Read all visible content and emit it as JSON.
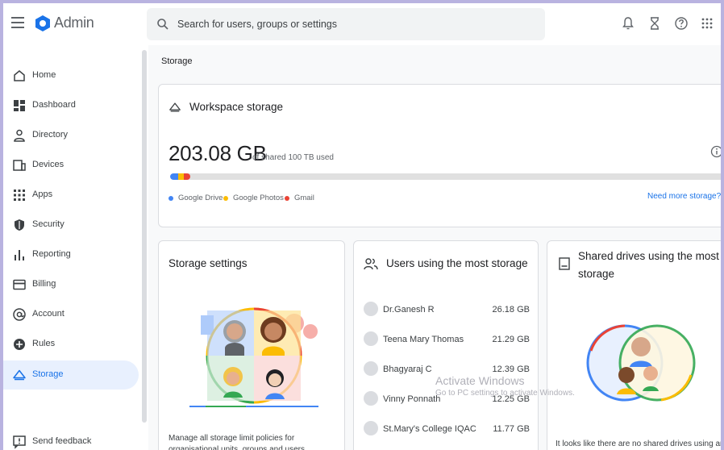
{
  "header": {
    "app_title": "Admin",
    "search_placeholder": "Search for users, groups or settings"
  },
  "sidebar": {
    "items": [
      {
        "label": "Home",
        "icon": "home-icon"
      },
      {
        "label": "Dashboard",
        "icon": "dashboard-icon"
      },
      {
        "label": "Directory",
        "icon": "person-icon"
      },
      {
        "label": "Devices",
        "icon": "devices-icon"
      },
      {
        "label": "Apps",
        "icon": "apps-grid-icon"
      },
      {
        "label": "Security",
        "icon": "shield-icon"
      },
      {
        "label": "Reporting",
        "icon": "bar-chart-icon"
      },
      {
        "label": "Billing",
        "icon": "credit-card-icon"
      },
      {
        "label": "Account",
        "icon": "at-sign-icon"
      },
      {
        "label": "Rules",
        "icon": "rules-icon"
      },
      {
        "label": "Storage",
        "icon": "cloud-icon",
        "active": true
      }
    ],
    "feedback_label": "Send feedback"
  },
  "breadcrumb": "Storage",
  "workspace": {
    "title": "Workspace storage",
    "used_value": "203.08 GB",
    "used_suffix": "of shared 100 TB used",
    "legend": [
      "Google Drive",
      "Google Photos",
      "Gmail"
    ],
    "more_link": "Need more storage?",
    "colors": {
      "drive": "#4285f4",
      "photos": "#fbbc04",
      "gmail": "#ea4335"
    }
  },
  "storage_settings": {
    "title": "Storage settings",
    "description": "Manage all storage limit policies for organisational units, groups and users"
  },
  "users": {
    "title": "Users using the most storage",
    "rows": [
      {
        "name": "Dr.Ganesh R",
        "size": "26.18 GB"
      },
      {
        "name": "Teena Mary Thomas",
        "size": "21.29 GB"
      },
      {
        "name": "Bhagyaraj C",
        "size": "12.39 GB"
      },
      {
        "name": "Vinny Ponnath",
        "size": "12.25 GB"
      },
      {
        "name": "St.Mary's College IQAC",
        "size": "11.77 GB"
      }
    ]
  },
  "shared_drives": {
    "title_line1": "Shared drives using the most",
    "title_line2": "storage",
    "description": "It looks like there are no shared drives using any"
  },
  "watermark": {
    "title": "Activate Windows",
    "subtitle": "Go to PC settings to activate Windows."
  }
}
